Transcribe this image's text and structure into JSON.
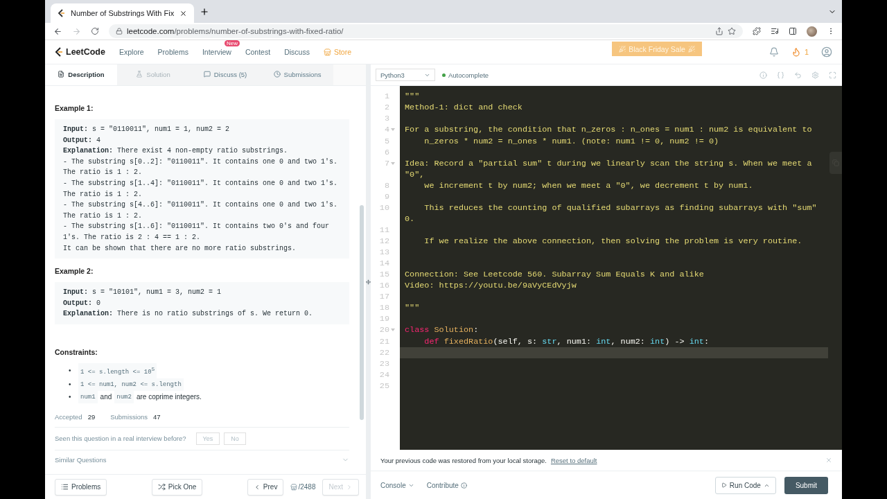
{
  "browser": {
    "tab_title": "Number of Substrings With Fix",
    "url_host": "leetcode.com",
    "url_path": "/problems/number-of-substrings-with-fixed-ratio/",
    "forward_disabled": true
  },
  "nav": {
    "logo": "LeetCode",
    "items": [
      {
        "label": "Explore",
        "kind": "link"
      },
      {
        "label": "Problems",
        "kind": "link"
      },
      {
        "label": "Interview",
        "kind": "link",
        "badge": "New"
      },
      {
        "label": "Contest",
        "kind": "link"
      },
      {
        "label": "Discuss",
        "kind": "link"
      },
      {
        "label": "Store",
        "kind": "store"
      }
    ],
    "promo": "Black Friday Sale",
    "streak": "1"
  },
  "description": {
    "tabs": [
      {
        "label": "Description",
        "kind": "description",
        "selected": true,
        "disabled": false
      },
      {
        "label": "Solution",
        "kind": "solution",
        "selected": false,
        "disabled": true
      },
      {
        "label": "Discuss (5)",
        "kind": "discuss",
        "selected": false,
        "disabled": false
      },
      {
        "label": "Submissions",
        "kind": "submissions",
        "selected": false,
        "disabled": false
      }
    ],
    "examples": [
      {
        "title": "Example 1:",
        "lines": [
          "**Input:** s = \"0110011\", num1 = 1, num2 = 2",
          "**Output:** 4",
          "**Explanation:** There exist 4 non-empty ratio substrings.",
          "- The substring s[0..2]: \"0110011\". It contains one 0 and two 1's.",
          "The ratio is 1 : 2.",
          "- The substring s[1..4]: \"0110011\". It contains one 0 and two 1's.",
          "The ratio is 1 : 2.",
          "- The substring s[4..6]: \"0110011\". It contains one 0 and two 1's.",
          "The ratio is 1 : 2.",
          "- The substring s[1..6]: \"0110011\". It contains two 0's and four",
          "1's. The ratio is 2 : 4 == 1 : 2.",
          "It can be shown that there are no more ratio substrings."
        ]
      },
      {
        "title": "Example 2:",
        "lines": [
          "**Input:** s = \"10101\", num1 = 3, num2 = 1",
          "**Output:** 0",
          "**Explanation:** There is no ratio substrings of s. We return 0."
        ]
      }
    ],
    "constraints_title": "Constraints:",
    "constraints": [
      {
        "marker": "•",
        "segments": [
          {
            "kind": "code",
            "text": "1 <= s.length <= 10$^{5}$"
          }
        ]
      },
      {
        "marker": "•",
        "segments": [
          {
            "kind": "code",
            "text": "1 <= num1, num2 <= s.length"
          }
        ]
      },
      {
        "marker": "•",
        "segments": [
          {
            "kind": "code",
            "text": "num1"
          },
          {
            "kind": "text",
            "text": "and"
          },
          {
            "kind": "code",
            "text": "num2"
          },
          {
            "kind": "text",
            "text": "are coprime integers."
          }
        ]
      }
    ],
    "stats": [
      {
        "label": "Accepted",
        "value": "29"
      },
      {
        "label": "Submissions",
        "value": "47"
      }
    ],
    "feedback": {
      "question": "Seen this question in a real interview before?",
      "options": [
        "Yes",
        "No"
      ]
    },
    "similar": "Similar Questions"
  },
  "footer": {
    "problems": "Problems",
    "pick": "Pick One",
    "prev": "Prev",
    "counter": "/2488",
    "next": "Next",
    "next_disabled": true
  },
  "editor": {
    "language": "Python3",
    "autocomplete": "Autocomplete",
    "autocomplete_on": true,
    "lines": [
      {
        "number": "1",
        "fold": false,
        "active": false,
        "tokens": [
          {
            "kind": "string",
            "text": "\"\"\""
          }
        ]
      },
      {
        "number": "2",
        "fold": false,
        "active": false,
        "tokens": [
          {
            "kind": "string",
            "text": "Method-1: dict and check"
          }
        ]
      },
      {
        "number": "3",
        "fold": false,
        "active": false
      },
      {
        "number": "4",
        "fold": true,
        "active": false,
        "tokens": [
          {
            "kind": "string",
            "text": "For a substring, the condition that n_zeros : n_ones = num1 : num2 is equivalent to"
          }
        ]
      },
      {
        "number": "5",
        "fold": false,
        "active": false,
        "tokens": [
          {
            "kind": "string",
            "text": "    n_zeros * num2 = n_ones * num1. (note: num1 != 0, num2 != 0)"
          }
        ]
      },
      {
        "number": "6",
        "fold": false,
        "active": false
      },
      {
        "number": "7",
        "fold": true,
        "active": false,
        "tokens": [
          {
            "kind": "string",
            "text": "Idea: Record a \"partial sum\" t during we linearly scan the string s. When we meet a \"0\","
          }
        ]
      },
      {
        "number": "8",
        "fold": false,
        "active": false,
        "tokens": [
          {
            "kind": "string",
            "text": "    we increment t by num2; when we meet a \"0\", we decrement t by num1."
          }
        ]
      },
      {
        "number": "9",
        "fold": false,
        "active": false
      },
      {
        "number": "10",
        "fold": false,
        "active": false,
        "tokens": [
          {
            "kind": "string",
            "text": "    This reduces the counting of qualified subarrays as finding subarrays with \"sum\" 0."
          }
        ]
      },
      {
        "number": "11",
        "fold": false,
        "active": false
      },
      {
        "number": "12",
        "fold": false,
        "active": false,
        "tokens": [
          {
            "kind": "string",
            "text": "    If we realize the above connection, then solving the problem is very routine."
          }
        ]
      },
      {
        "number": "13",
        "fold": false,
        "active": false
      },
      {
        "number": "14",
        "fold": false,
        "active": false
      },
      {
        "number": "15",
        "fold": false,
        "active": false,
        "tokens": [
          {
            "kind": "string",
            "text": "Connection: See Leetcode 560. Subarray Sum Equals K and alike"
          }
        ]
      },
      {
        "number": "16",
        "fold": false,
        "active": false,
        "tokens": [
          {
            "kind": "string",
            "text": "Video: https://youtu.be/9aVyCEdVyjw"
          }
        ]
      },
      {
        "number": "17",
        "fold": false,
        "active": false
      },
      {
        "number": "18",
        "fold": false,
        "active": false,
        "tokens": [
          {
            "kind": "string",
            "text": "\"\"\""
          }
        ]
      },
      {
        "number": "19",
        "fold": false,
        "active": false
      },
      {
        "number": "20",
        "fold": true,
        "active": false,
        "tokens": [
          {
            "kind": "keyword",
            "text": "class"
          },
          {
            "kind": "name",
            "text": " Solution"
          },
          {
            "kind": "plain",
            "text": ":"
          }
        ]
      },
      {
        "number": "21",
        "fold": false,
        "active": false,
        "tokens": [
          {
            "kind": "keyword",
            "text": "    def"
          },
          {
            "kind": "name",
            "text": " fixedRatio"
          },
          {
            "kind": "plain",
            "text": "(self, s: "
          },
          {
            "kind": "type",
            "text": "str"
          },
          {
            "kind": "plain",
            "text": ", num1: "
          },
          {
            "kind": "type",
            "text": "int"
          },
          {
            "kind": "plain",
            "text": ", num2: "
          },
          {
            "kind": "type",
            "text": "int"
          },
          {
            "kind": "plain",
            "text": ") -> "
          },
          {
            "kind": "type",
            "text": "int"
          },
          {
            "kind": "plain",
            "text": ":"
          }
        ]
      },
      {
        "number": "22",
        "fold": false,
        "active": true
      },
      {
        "number": "23",
        "fold": false,
        "active": false
      },
      {
        "number": "24",
        "fold": false,
        "active": false
      },
      {
        "number": "25",
        "fold": false,
        "active": false
      }
    ],
    "notice": "Your previous code was restored from your local storage.",
    "reset": "Reset to default",
    "console": "Console",
    "contribute": "Contribute",
    "run": "Run Code",
    "submit": "Submit"
  }
}
